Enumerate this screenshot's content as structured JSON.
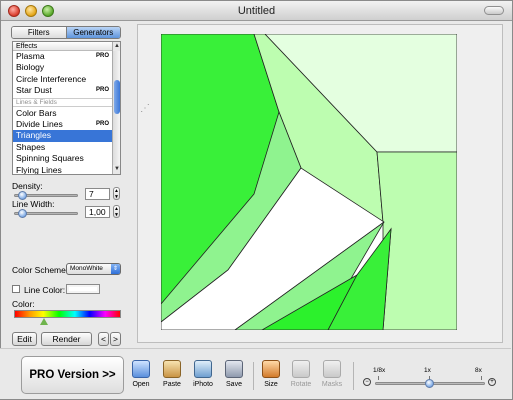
{
  "window": {
    "title": "Untitled"
  },
  "tabs": [
    "Filters",
    "Generators"
  ],
  "generator_list": {
    "header": "Effects",
    "items": [
      {
        "label": "Plasma",
        "badge": "PRO"
      },
      {
        "label": "Biology",
        "badge": ""
      },
      {
        "label": "Circle Interference",
        "badge": ""
      },
      {
        "label": "Star Dust",
        "badge": "PRO"
      },
      {
        "label": "Lines & Fields",
        "badge": "",
        "separator": true
      },
      {
        "label": "Color Bars",
        "badge": ""
      },
      {
        "label": "Divide Lines",
        "badge": "PRO"
      },
      {
        "label": "Triangles",
        "badge": "",
        "selected": true
      },
      {
        "label": "Shapes",
        "badge": ""
      },
      {
        "label": "Spinning Squares",
        "badge": ""
      },
      {
        "label": "Flying Lines",
        "badge": ""
      }
    ]
  },
  "params": {
    "density_label": "Density:",
    "density_value": "7",
    "line_width_label": "Line Width:",
    "line_width_value": "1,00",
    "color_scheme_label": "Color Scheme:",
    "color_scheme_value": "MonoWhite",
    "line_color_label": "Line Color:",
    "color_label": "Color:"
  },
  "buttons": {
    "edit": "Edit",
    "render": "Render",
    "prev": "<",
    "next": ">",
    "pro": "PRO Version >>"
  },
  "toolbar": {
    "items": [
      {
        "label": "Open",
        "icon": "open-icon"
      },
      {
        "label": "Paste",
        "icon": "paste-icon"
      },
      {
        "label": "iPhoto",
        "icon": "iphoto-icon"
      },
      {
        "label": "Save",
        "icon": "save-icon"
      },
      {
        "label": "Size",
        "icon": "size-icon"
      },
      {
        "label": "Rotate",
        "icon": "rotate-icon",
        "disabled": true
      },
      {
        "label": "Masks",
        "icon": "masks-icon",
        "disabled": true
      }
    ]
  },
  "zoom": {
    "labels": [
      "1/8x",
      "1x",
      "8x"
    ],
    "level": "1x"
  },
  "colors": {
    "selection": "#3875d7",
    "green_bright": "#39f039",
    "green_mid": "#8ff38f",
    "green_light": "#bdfdb0",
    "green_pale": "#e4ffe0"
  }
}
